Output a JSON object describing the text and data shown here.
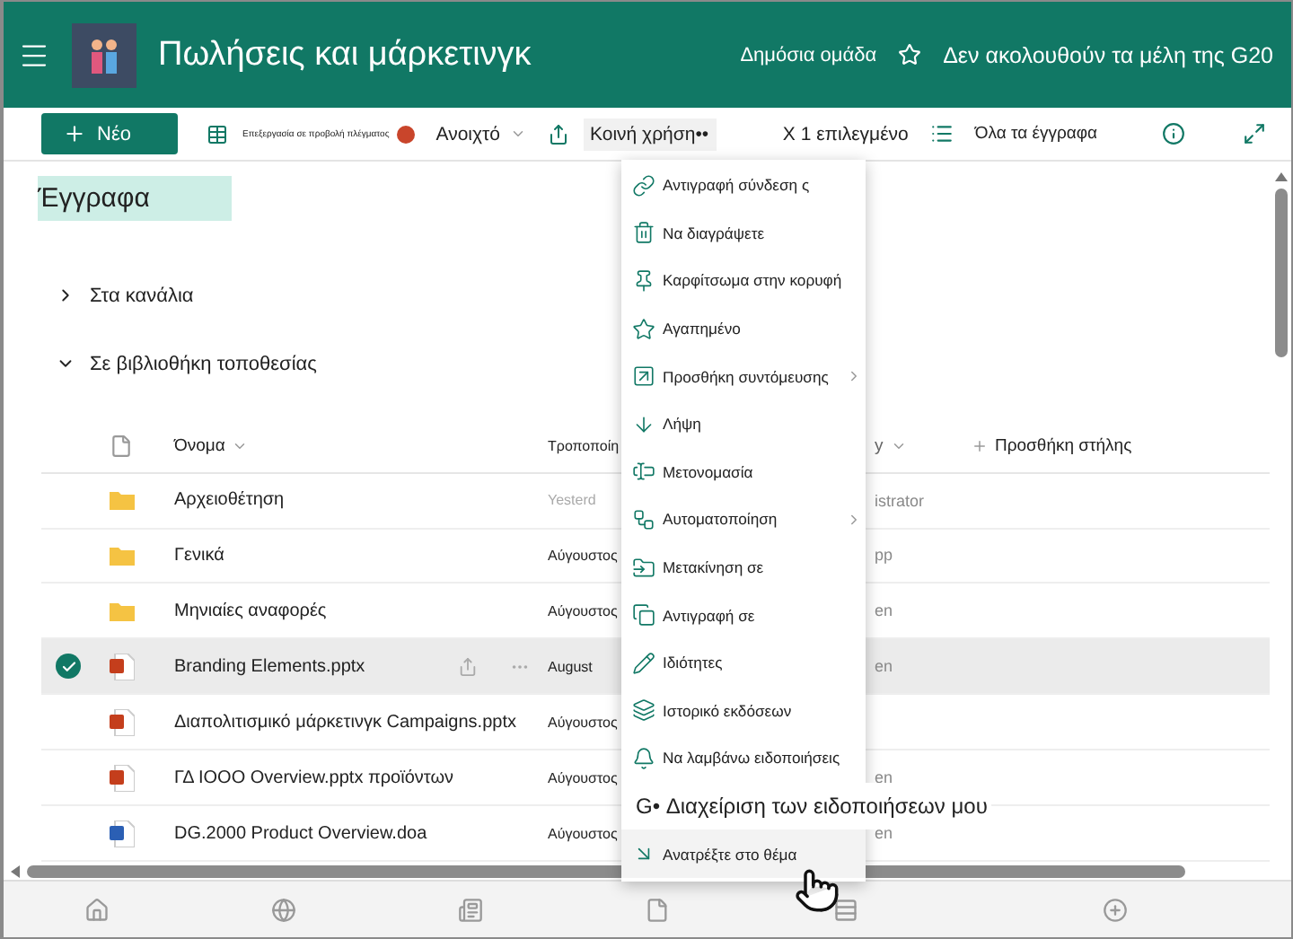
{
  "header": {
    "title": "Πωλήσεις και μάρκετινγκ",
    "privacy": "Δημόσια ομάδα",
    "follow": "Δεν ακολουθούν τα μέλη της G20"
  },
  "toolbar": {
    "new_button": "Νέο",
    "grid_edit": "Επεξεργασία σε προβολή πλέγματος",
    "open": "Ανοιχτό",
    "share": "Κοινή χρήση",
    "share_more": "••",
    "selection": "X 1 επιλεγμένο",
    "view": "Όλα τα έγγραφα"
  },
  "library": {
    "title": "Έγγραφα",
    "groups": [
      {
        "label": "Στα κανάλια",
        "expanded": false
      },
      {
        "label": "Σε βιβλιοθήκη τοποθεσίας",
        "expanded": true
      }
    ]
  },
  "table": {
    "name_column": "Όνομα",
    "modified_column": "Τροποποίη",
    "column_3": "y",
    "add_column": "Προσθήκη στήλης",
    "rows": [
      {
        "kind": "folder",
        "name": "Αρχειοθέτηση",
        "modified": "Yesterd",
        "column_3": "istrator",
        "selected": false
      },
      {
        "kind": "folder",
        "name": "Γενικά",
        "modified": "Αύγουστος",
        "column_3": "pp",
        "selected": false
      },
      {
        "kind": "folder",
        "name": "Μηνιαίες αναφορές",
        "modified": "Αύγουστος",
        "column_3": "en",
        "selected": false
      },
      {
        "kind": "powerpoint",
        "name": "Branding Elements.pptx",
        "modified": "August",
        "column_3": "en",
        "selected": true
      },
      {
        "kind": "powerpoint",
        "name": "Διαπολιτισμικό μάρκετινγκ Campaigns.pptx",
        "modified": "Αύγουστος",
        "selected": false
      },
      {
        "kind": "powerpoint",
        "name": "ΓΔ IOOO Overview.pptx προϊόντων",
        "modified": "Αύγουστος",
        "column_3": "en",
        "selected": false
      },
      {
        "kind": "word",
        "name": "DG.2000 Product Overview.doa",
        "modified": "Αύγουστος",
        "column_3": "en",
        "selected": false
      }
    ]
  },
  "menu": [
    {
      "kind": "link",
      "label": "Αντιγραφή σύνδεση ς",
      "submenu": false
    },
    {
      "kind": "delete",
      "label": "Να διαγράψετε",
      "submenu": false
    },
    {
      "kind": "pin",
      "label": "Καρφίτσωμα στην κορυφή",
      "submenu": false
    },
    {
      "kind": "favorite",
      "label": "Αγαπημένο",
      "submenu": false
    },
    {
      "kind": "shortcut",
      "label": "Προσθήκη συντόμευσης",
      "submenu": true
    },
    {
      "kind": "download",
      "label": "Λήψη",
      "submenu": false
    },
    {
      "kind": "rename",
      "label": "Μετονομασία",
      "submenu": false
    },
    {
      "kind": "automate",
      "label": "Αυτοματοποίηση",
      "submenu": true
    },
    {
      "kind": "move",
      "label": "Μετακίνηση σε",
      "submenu": false
    },
    {
      "kind": "copy",
      "label": "Αντιγραφή σε",
      "submenu": false
    },
    {
      "kind": "properties",
      "label": "Ιδιότητες",
      "submenu": false
    },
    {
      "kind": "history",
      "label": "Ιστορικό εκδόσεων",
      "submenu": false
    },
    {
      "kind": "alert",
      "label": "Να λαμβάνω ειδοποιήσεις",
      "submenu": false
    },
    {
      "kind": "manage",
      "label": "G• Διαχείριση των ειδοποιήσεων μου",
      "submenu": false
    },
    {
      "kind": "goto",
      "label": "Ανατρέξτε στο θέμα",
      "submenu": false
    }
  ]
}
